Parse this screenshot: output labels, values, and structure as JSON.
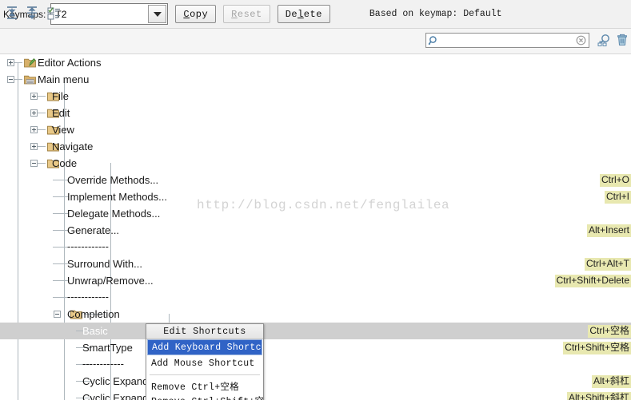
{
  "topbar": {
    "keymaps_label": "Keymaps:",
    "keymap_value": "T2",
    "dropdown_icon": "chevron-down-icon",
    "copy_label": "Copy",
    "reset_label": "Reset",
    "delete_label": "Delete",
    "based_on_label": "Based on keymap: Default"
  },
  "toolbar": {
    "expand_all_icon": "expand-all-icon",
    "collapse_all_icon": "collapse-all-icon",
    "filter_icon": "filter-checkbox-icon",
    "search_icon": "search-icon",
    "search_value": "",
    "search_placeholder": "",
    "clear_icon": "clear-circle-icon",
    "find_shortcut_icon": "find-by-shortcut-icon",
    "delete_icon": "trash-icon"
  },
  "watermark": "http://blog.csdn.net/fenglailea",
  "tree": {
    "rows": [
      {
        "label": "Editor Actions",
        "depth": 0,
        "toggle": "plus",
        "icon": "editor-actions-icon",
        "shortcut": ""
      },
      {
        "label": "Main menu",
        "depth": 0,
        "toggle": "minus",
        "icon": "main-menu-icon",
        "shortcut": ""
      },
      {
        "label": "File",
        "depth": 1,
        "toggle": "plus",
        "icon": "folder-icon",
        "shortcut": ""
      },
      {
        "label": "Edit",
        "depth": 1,
        "toggle": "plus",
        "icon": "folder-icon",
        "shortcut": ""
      },
      {
        "label": "View",
        "depth": 1,
        "toggle": "plus",
        "icon": "folder-icon",
        "shortcut": ""
      },
      {
        "label": "Navigate",
        "depth": 1,
        "toggle": "plus",
        "icon": "folder-icon",
        "shortcut": ""
      },
      {
        "label": "Code",
        "depth": 1,
        "toggle": "minus",
        "icon": "folder-icon",
        "shortcut": ""
      },
      {
        "label": "Override Methods...",
        "depth": 2,
        "toggle": "",
        "icon": "",
        "shortcut": "Ctrl+O"
      },
      {
        "label": "Implement Methods...",
        "depth": 2,
        "toggle": "",
        "icon": "",
        "shortcut": "Ctrl+I"
      },
      {
        "label": "Delegate Methods...",
        "depth": 2,
        "toggle": "",
        "icon": "",
        "shortcut": ""
      },
      {
        "label": "Generate...",
        "depth": 2,
        "toggle": "",
        "icon": "",
        "shortcut": "Alt+Insert"
      },
      {
        "label": "------------",
        "depth": 2,
        "toggle": "",
        "icon": "",
        "shortcut": "",
        "separator": true
      },
      {
        "label": "Surround With...",
        "depth": 2,
        "toggle": "",
        "icon": "",
        "shortcut": "Ctrl+Alt+T"
      },
      {
        "label": "Unwrap/Remove...",
        "depth": 2,
        "toggle": "",
        "icon": "",
        "shortcut": "Ctrl+Shift+Delete"
      },
      {
        "label": "------------",
        "depth": 2,
        "toggle": "",
        "icon": "",
        "shortcut": "",
        "separator": true
      },
      {
        "label": "Completion",
        "depth": 2,
        "toggle": "minus",
        "icon": "folder-icon",
        "shortcut": ""
      },
      {
        "label": "Basic",
        "depth": 3,
        "toggle": "",
        "icon": "",
        "shortcut": "Ctrl+空格",
        "selected": true
      },
      {
        "label": "SmartType",
        "depth": 3,
        "toggle": "",
        "icon": "",
        "shortcut": "Ctrl+Shift+空格"
      },
      {
        "label": "------------",
        "depth": 3,
        "toggle": "",
        "icon": "",
        "shortcut": "",
        "separator": true
      },
      {
        "label": "Cyclic Expand",
        "depth": 3,
        "toggle": "",
        "icon": "",
        "shortcut": "Alt+斜杠"
      },
      {
        "label": "Cyclic Expand",
        "depth": 3,
        "toggle": "",
        "icon": "",
        "shortcut": "Alt+Shift+斜杠"
      }
    ]
  },
  "popup": {
    "title": "Edit Shortcuts",
    "items": [
      {
        "label": "Add Keyboard Shortcut",
        "highlight": true
      },
      {
        "label": "Add Mouse Shortcut",
        "highlight": false
      },
      {
        "label": "Remove Ctrl+空格",
        "highlight": false,
        "sep_before": true
      },
      {
        "label": "Remove Ctrl+Shift+空格",
        "highlight": false,
        "clipped": true
      }
    ]
  },
  "colors": {
    "shortcut_bg": "#e8e8b0",
    "selection_bg": "#cfcfcf",
    "menu_highlight": "#3063c6",
    "folder": "#d7b06a"
  }
}
